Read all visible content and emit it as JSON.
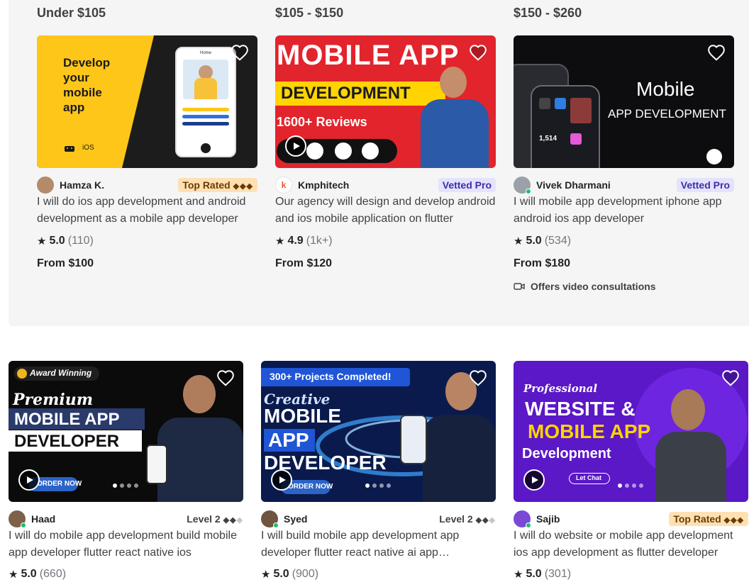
{
  "tiers": [
    {
      "title": "Under $105"
    },
    {
      "title": "$105 - $150"
    },
    {
      "title": "$150 - $260"
    }
  ],
  "cards": [
    {
      "seller": "Hamza K.",
      "badge": "Top Rated",
      "badge_type": "top",
      "title": "I will do ios app development and android development as a mobile app developer",
      "score": "5.0",
      "count": "(110)",
      "price": "From $100",
      "thumb_text": {
        "line1": "Develop",
        "line2": "your",
        "line3": "mobile",
        "line4": "app",
        "ios": "iOS",
        "home": "Home"
      }
    },
    {
      "seller": "Kmphitech",
      "badge": "Vetted Pro",
      "badge_type": "vetted",
      "title": "Our agency will design and develop android and ios mobile application on flutter",
      "score": "4.9",
      "count": "(1k+)",
      "price": "From $120",
      "thumb_text": {
        "headline": "MOBILE APP",
        "sub": "DEVELOPMENT",
        "reviews": "1600+ Reviews"
      }
    },
    {
      "seller": "Vivek Dharmani",
      "badge": "Vetted Pro",
      "badge_type": "vetted",
      "title": "I will mobile app development iphone app android ios app developer",
      "score": "5.0",
      "count": "(534)",
      "price": "From $180",
      "consult": "Offers video consultations",
      "thumb_text": {
        "headline": "Mobile",
        "sub": "APP DEVELOPMENT",
        "stat": "1,514"
      }
    },
    {
      "seller": "Haad",
      "badge": "Level 2",
      "badge_type": "level",
      "title": "I will do mobile app development build mobile app developer flutter react native ios",
      "score": "5.0",
      "count": "(660)",
      "thumb_text": {
        "award": "Award Winning",
        "premium": "Premium",
        "l1": "MOBILE APP",
        "l2": "DEVELOPER",
        "cta": "ORDER NOW"
      }
    },
    {
      "seller": "Syed",
      "badge": "Level 2",
      "badge_type": "level",
      "title": "I will build mobile app development app developer flutter react native ai app development",
      "score": "5.0",
      "count": "(900)",
      "thumb_text": {
        "banner": "300+ Projects Completed!",
        "creative": "Creative",
        "l1": "MOBILE",
        "l2": "APP",
        "l3": "DEVELOPER",
        "cta": "ORDER NOW"
      }
    },
    {
      "seller": "Sajib",
      "badge": "Top Rated",
      "badge_type": "top",
      "title": "I will do website or mobile app development ios app development as flutter developer",
      "score": "5.0",
      "count": "(301)",
      "thumb_text": {
        "professional": "Professional",
        "l1": "WEBSITE &",
        "l2": "MOBILE APP",
        "l3": "Development",
        "chat": "Let Chat"
      }
    }
  ],
  "icons": {
    "heart": "heart-icon",
    "star": "star-icon",
    "play": "play-icon",
    "video": "video-camera-icon"
  },
  "colors": {
    "top_rated_bg": "#ffe0b3",
    "vetted_bg": "#e4e3ff",
    "online": "#1dbf73"
  }
}
